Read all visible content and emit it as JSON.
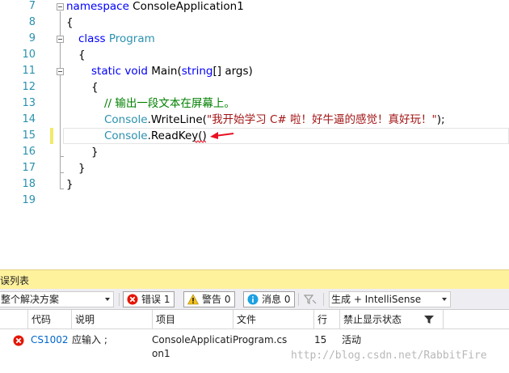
{
  "editor": {
    "line_numbers": [
      "7",
      "8",
      "9",
      "10",
      "11",
      "12",
      "13",
      "14",
      "15",
      "16",
      "17",
      "18",
      "19"
    ],
    "tokens": {
      "namespace_kw": "namespace",
      "namespace_name": " ConsoleApplication1",
      "brace_open": "{",
      "brace_close": "}",
      "class_kw": "class",
      "class_name": "Program",
      "static_kw": "static",
      "void_kw": "void",
      "main_sig": " Main(",
      "string_kw": "string",
      "args": "[] args)",
      "comment": "// 输出一段文本在屏幕上。",
      "console1": "Console",
      "writeline": ".WriteLine(",
      "string_literal": "\"我开始学习 C# 啦！好牛逼的感觉！真好玩！\"",
      "writeline_end": ");",
      "console2": "Console",
      "readkey": ".ReadKey()"
    },
    "colors": {
      "keyword": "#0000ff",
      "type": "#2b91af",
      "comment": "#008000",
      "string": "#a31515",
      "change_marker": "#f3ea6a",
      "arrow": "#e81123"
    }
  },
  "error_list": {
    "title": "误列表",
    "scope_combo": "整个解决方案",
    "errors_btn": "错误 1",
    "warnings_btn": "警告 0",
    "messages_btn": "消息 0",
    "source_combo": "生成 + IntelliSense",
    "columns": [
      "代码",
      "说明",
      "项目",
      "文件",
      "行",
      "禁止显示状态"
    ],
    "rows": [
      {
        "code": "CS1002",
        "description": "应输入 ;",
        "project_line1": "ConsoleApplicati",
        "project_line2": "on1",
        "file": "Program.cs",
        "line": "15",
        "suppression": "活动"
      }
    ],
    "watermark": "http://blog.csdn.net/RabbitFire"
  }
}
